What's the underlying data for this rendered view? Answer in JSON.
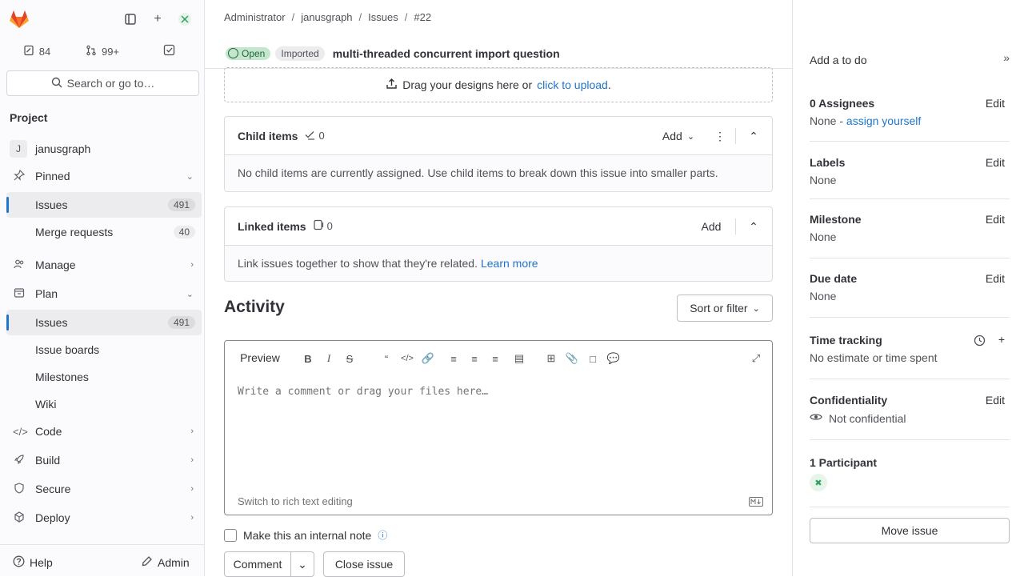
{
  "sidebar": {
    "counts": {
      "issues": "84",
      "merge_requests": "99+"
    },
    "search_label": "Search or go to…",
    "section_title": "Project",
    "project_name": "janusgraph",
    "project_initial": "J",
    "items": [
      {
        "label": "Pinned"
      },
      {
        "label": "Issues",
        "badge": "491"
      },
      {
        "label": "Merge requests",
        "badge": "40"
      },
      {
        "label": "Manage"
      },
      {
        "label": "Plan"
      },
      {
        "label": "Issues",
        "badge": "491"
      },
      {
        "label": "Issue boards"
      },
      {
        "label": "Milestones"
      },
      {
        "label": "Wiki"
      },
      {
        "label": "Code"
      },
      {
        "label": "Build"
      },
      {
        "label": "Secure"
      },
      {
        "label": "Deploy"
      }
    ],
    "help_label": "Help",
    "admin_label": "Admin"
  },
  "breadcrumb": [
    "Administrator",
    "janusgraph",
    "Issues",
    "#22"
  ],
  "header": {
    "status": "Open",
    "imported": "Imported",
    "title": "multi-threaded concurrent import question"
  },
  "dropzone": {
    "text": "Drag your designs here or",
    "link": "click to upload",
    "end": "."
  },
  "child_items": {
    "title": "Child items",
    "count": "0",
    "add_label": "Add",
    "empty": "No child items are currently assigned. Use child items to break down this issue into smaller parts."
  },
  "linked_items": {
    "title": "Linked items",
    "count": "0",
    "add_label": "Add",
    "empty": "Link issues together to show that they're related.",
    "learn_more": "Learn more"
  },
  "activity": {
    "title": "Activity",
    "sort_label": "Sort or filter"
  },
  "editor": {
    "preview_label": "Preview",
    "placeholder": "Write a comment or drag your files here…",
    "switch_label": "Switch to rich text editing",
    "internal_note_label": "Make this an internal note",
    "comment_label": "Comment",
    "close_label": "Close issue"
  },
  "right_sidebar": {
    "todo_label": "Add a to do",
    "assignees_title": "0 Assignees",
    "assignees_value": "None -",
    "assign_yourself": "assign yourself",
    "labels_title": "Labels",
    "labels_value": "None",
    "milestone_title": "Milestone",
    "milestone_value": "None",
    "due_title": "Due date",
    "due_value": "None",
    "time_title": "Time tracking",
    "time_value": "No estimate or time spent",
    "conf_title": "Confidentiality",
    "conf_value": "Not confidential",
    "participants_title": "1 Participant",
    "edit_label": "Edit",
    "move_label": "Move issue"
  }
}
